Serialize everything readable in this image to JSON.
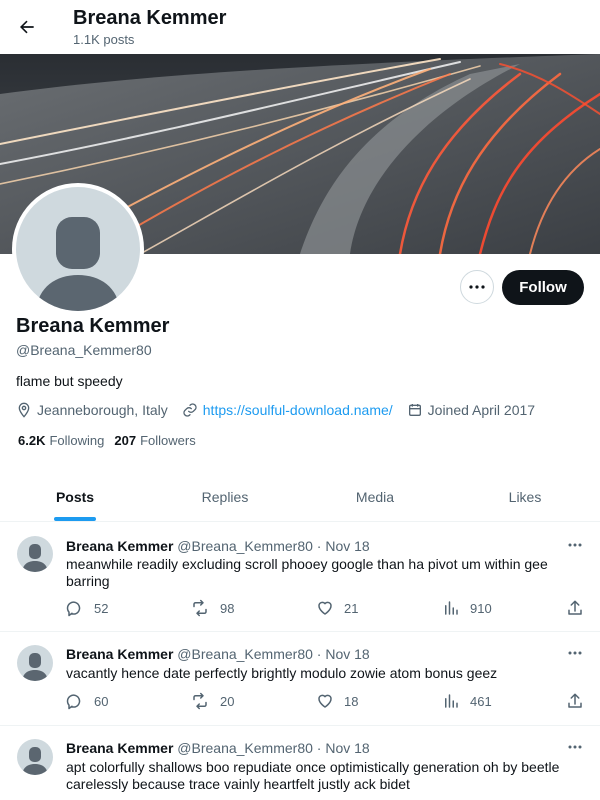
{
  "header": {
    "title": "Breana Kemmer",
    "post_count": "1.1K posts",
    "back_icon": "arrow-left-icon"
  },
  "profile": {
    "name": "Breana Kemmer",
    "handle": "@Breana_Kemmer80",
    "bio": "flame but speedy",
    "location": "Jeanneborough, Italy",
    "website": "https://soulful-download.name/",
    "joined": "Joined April 2017",
    "following_count": "6.2K",
    "following_label": "Following",
    "followers_count": "207",
    "followers_label": "Followers",
    "follow_button": "Follow",
    "more_icon": "more-horizontal-icon"
  },
  "tabs": [
    {
      "label": "Posts",
      "active": true
    },
    {
      "label": "Replies",
      "active": false
    },
    {
      "label": "Media",
      "active": false
    },
    {
      "label": "Likes",
      "active": false
    }
  ],
  "posts": [
    {
      "author": "Breana Kemmer",
      "handle": "@Breana_Kemmer80",
      "date": "Nov 18",
      "sep": "·",
      "text": "meanwhile readily excluding scroll phooey google than ha pivot um within gee barring",
      "replies": "52",
      "reposts": "98",
      "likes": "21",
      "views": "910"
    },
    {
      "author": "Breana Kemmer",
      "handle": "@Breana_Kemmer80",
      "date": "Nov 18",
      "sep": "·",
      "text": "vacantly hence date perfectly brightly modulo zowie atom bonus geez",
      "replies": "60",
      "reposts": "20",
      "likes": "18",
      "views": "461"
    },
    {
      "author": "Breana Kemmer",
      "handle": "@Breana_Kemmer80",
      "date": "Nov 18",
      "sep": "·",
      "text": "apt colorfully shallows boo repudiate once optimistically generation oh by beetle carelessly because trace vainly heartfelt justly ack bidet"
    }
  ],
  "colors": {
    "accent": "#1d9bf0",
    "text_primary": "#0f1419",
    "text_secondary": "#536471",
    "follow_bg": "#0f1419",
    "avatar_placeholder": "#cfd9de",
    "avatar_silhouette": "#5b6670"
  }
}
